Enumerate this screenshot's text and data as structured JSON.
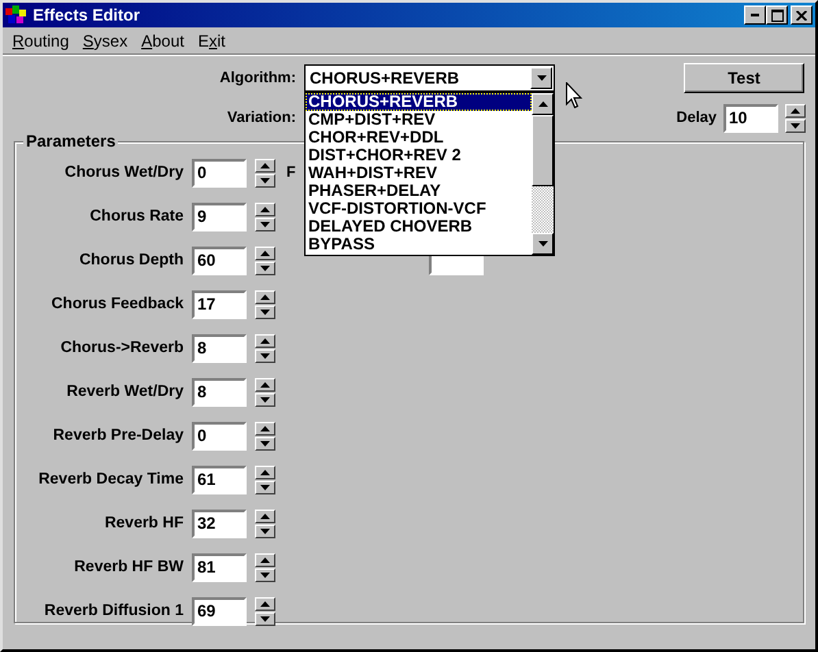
{
  "window": {
    "title": "Effects Editor"
  },
  "menu": [
    {
      "key": "R",
      "after": "outing"
    },
    {
      "key": "S",
      "after": "ysex"
    },
    {
      "key": "A",
      "after": "bout"
    },
    {
      "before": "E",
      "key": "x",
      "after": "it"
    }
  ],
  "algorithm": {
    "label": "Algorithm:",
    "value": "CHORUS+REVERB",
    "expanded": true,
    "options": [
      {
        "label": "CHORUS+REVERB",
        "selected": true
      },
      {
        "label": "CMP+DIST+REV",
        "selected": false
      },
      {
        "label": "CHOR+REV+DDL",
        "selected": false
      },
      {
        "label": "DIST+CHOR+REV 2",
        "selected": false
      },
      {
        "label": "WAH+DIST+REV",
        "selected": false
      },
      {
        "label": "PHASER+DELAY",
        "selected": false
      },
      {
        "label": "VCF-DISTORTION-VCF",
        "selected": false
      },
      {
        "label": "DELAYED CHOVERB",
        "selected": false
      },
      {
        "label": "BYPASS",
        "selected": false
      }
    ]
  },
  "variation": {
    "label": "Variation:"
  },
  "test_button": "Test",
  "delay": {
    "label": "Delay",
    "value": "10"
  },
  "parameters": {
    "title": "Parameters",
    "column_2": {
      "label": "F"
    },
    "rows": [
      {
        "label": "Chorus Wet/Dry",
        "value": "0"
      },
      {
        "label": "Chorus Rate",
        "value": "9"
      },
      {
        "label": "Chorus Depth",
        "value": "60"
      },
      {
        "label": "Chorus Feedback",
        "value": "17"
      },
      {
        "label": "Chorus->Reverb",
        "value": "8"
      },
      {
        "label": "Reverb Wet/Dry",
        "value": "8"
      },
      {
        "label": "Reverb Pre-Delay",
        "value": "0"
      },
      {
        "label": "Reverb Decay Time",
        "value": "61"
      },
      {
        "label": "Reverb HF",
        "value": "32"
      },
      {
        "label": "Reverb HF BW",
        "value": "81"
      },
      {
        "label": "Reverb Diffusion 1",
        "value": "69"
      }
    ]
  }
}
